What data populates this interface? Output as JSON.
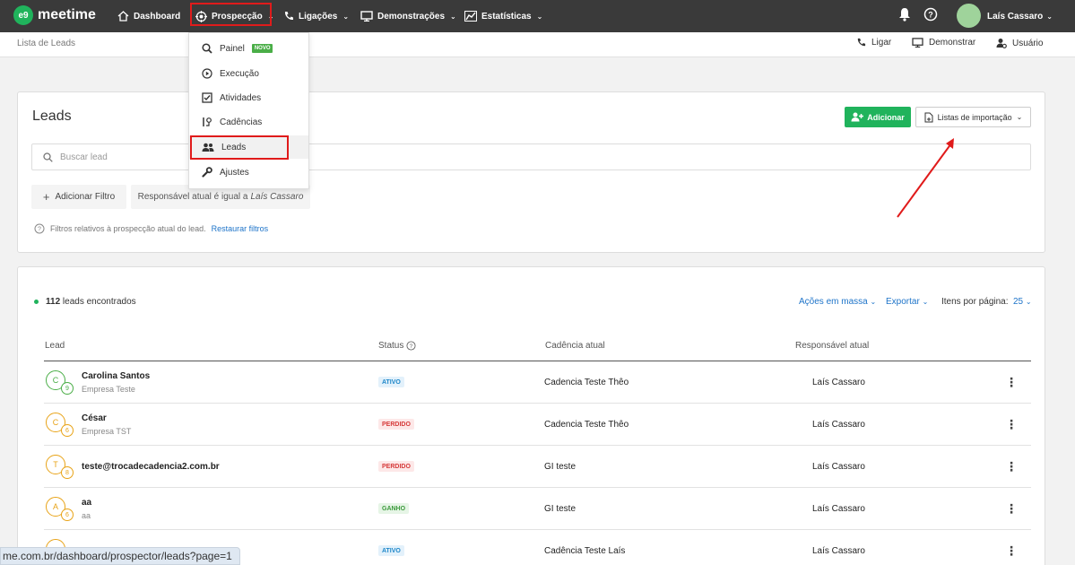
{
  "app": {
    "logo_mark": "e9",
    "logo_text": "meetime"
  },
  "nav": {
    "items": [
      {
        "label": "Dashboard",
        "icon": "home-icon"
      },
      {
        "label": "Prospecção",
        "icon": "target-icon"
      },
      {
        "label": "Ligações",
        "icon": "phone-icon"
      },
      {
        "label": "Demonstrações",
        "icon": "monitor-icon"
      },
      {
        "label": "Estatísticas",
        "icon": "chart-icon"
      }
    ],
    "user_name": "Laís Cassaro"
  },
  "subheader": {
    "breadcrumb": "Lista de Leads",
    "actions": [
      {
        "label": "Ligar"
      },
      {
        "label": "Demonstrar"
      },
      {
        "label": "Usuário"
      }
    ]
  },
  "dropdown": {
    "items": [
      {
        "label": "Painel",
        "badge": "NOVO"
      },
      {
        "label": "Execução"
      },
      {
        "label": "Atividades"
      },
      {
        "label": "Cadências"
      },
      {
        "label": "Leads"
      },
      {
        "label": "Ajustes"
      }
    ]
  },
  "leads_card": {
    "title": "Leads",
    "add_button": "Adicionar",
    "import_lists_button": "Listas de importação",
    "search_placeholder": "Buscar lead",
    "add_filter_button": "Adicionar Filtro",
    "filter_chip_prefix": "Responsável atual é igual a",
    "filter_chip_value": "Laís Cassaro",
    "filter_note": "Filtros relativos à prospecção atual do lead.",
    "restore_filters": "Restaurar filtros"
  },
  "table": {
    "count_bold": "112",
    "count_text": "leads encontrados",
    "bulk_actions": "Ações em massa",
    "export": "Exportar",
    "per_page_label": "Itens por página:",
    "per_page_value": "25",
    "headers": {
      "lead": "Lead",
      "status": "Status",
      "cadence": "Cadência atual",
      "responsible": "Responsável atual"
    },
    "rows": [
      {
        "initial": "C",
        "badge": "9",
        "name": "Carolina Santos",
        "company": "Empresa Teste",
        "status": "ATIVO",
        "cadence": "Cadencia Teste Thêo",
        "responsible": "Laís Cassaro"
      },
      {
        "initial": "C",
        "badge": "6",
        "name": "César",
        "company": "Empresa TST",
        "status": "PERDIDO",
        "cadence": "Cadencia Teste Thêo",
        "responsible": "Laís Cassaro"
      },
      {
        "initial": "T",
        "badge": "8",
        "name": "teste@trocadecadencia2.com.br",
        "company": "",
        "status": "PERDIDO",
        "cadence": "GI teste",
        "responsible": "Laís Cassaro"
      },
      {
        "initial": "A",
        "badge": "6",
        "name": "aa",
        "company": "aa",
        "status": "GANHO",
        "cadence": "GI teste",
        "responsible": "Laís Cassaro"
      },
      {
        "initial": "",
        "badge": "",
        "name": "",
        "company": "",
        "status": "ATIVO",
        "cadence": "Cadência Teste Laís",
        "responsible": "Laís Cassaro"
      }
    ]
  },
  "status_bar": {
    "url": "me.com.br/dashboard/prospector/leads?page=1"
  },
  "colors": {
    "brand_green": "#20b35c",
    "link_blue": "#1e74c9",
    "annotation_red": "#e01b1b",
    "nav_bg": "#3a3a3a"
  }
}
